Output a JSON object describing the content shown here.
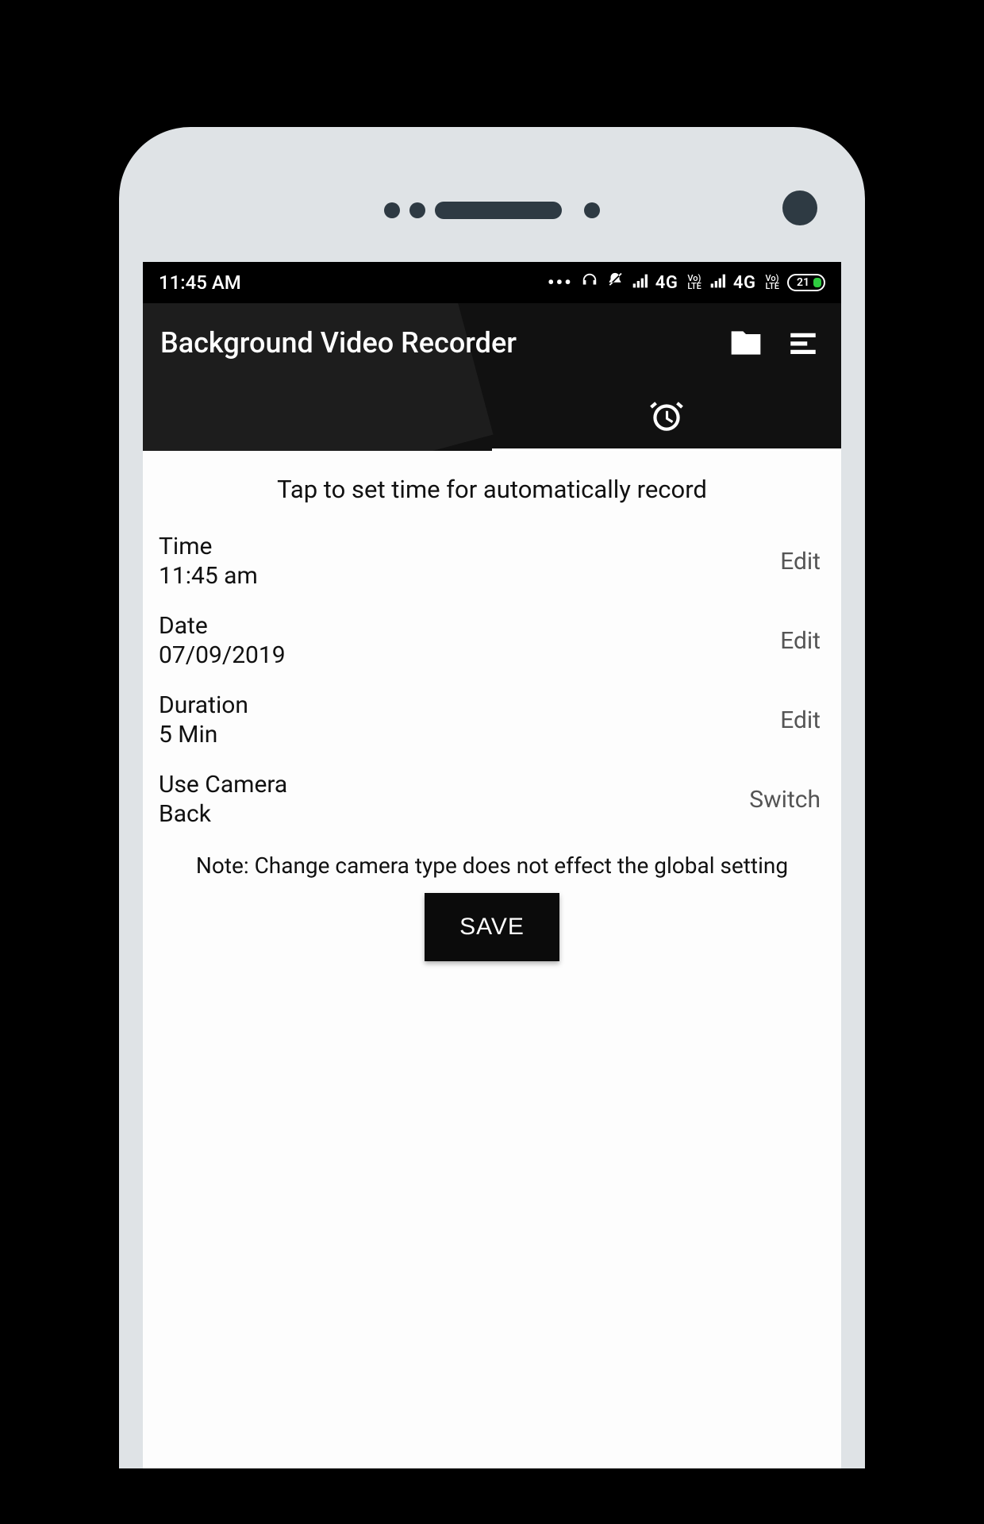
{
  "status_bar": {
    "time": "11:45 AM",
    "dots": "•••",
    "sim1_label": "4G",
    "sim1_sub_top": "Vo)",
    "sim1_sub_bot": "LTE",
    "sim2_label": "4G",
    "sim2_sub_top": "Vo)",
    "sim2_sub_bot": "LTE",
    "battery": "21"
  },
  "app_bar": {
    "title": "Background Video Recorder"
  },
  "content": {
    "heading": "Tap to set time for automatically record",
    "rows": [
      {
        "label": "Time",
        "value": "11:45 am",
        "action": "Edit"
      },
      {
        "label": "Date",
        "value": "07/09/2019",
        "action": "Edit"
      },
      {
        "label": "Duration",
        "value": "5 Min",
        "action": "Edit"
      },
      {
        "label": "Use Camera",
        "value": "Back",
        "action": "Switch"
      }
    ],
    "note": "Note: Change camera type does not effect the global setting",
    "save_label": "SAVE"
  }
}
